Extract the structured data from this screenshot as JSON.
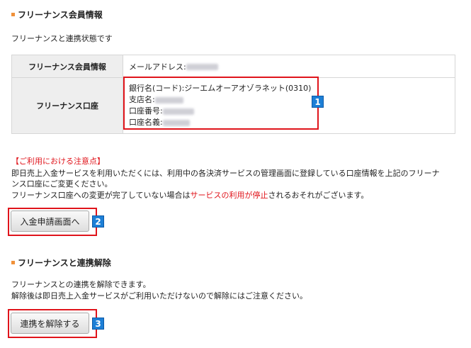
{
  "section1": {
    "title": "フリーナンス会員情報",
    "status_text": "フリーナンスと連携状態です"
  },
  "table": {
    "rows": [
      {
        "label": "フリーナンス会員情報",
        "email_label": "メールアドレス:"
      },
      {
        "label": "フリーナンス口座",
        "bank_line": "銀行名(コード):ジーエムオーアオゾラネット(0310)",
        "branch_label": "支店名:",
        "account_no_label": "口座番号:",
        "account_name_label": "口座名義:"
      }
    ]
  },
  "notice": {
    "title": "【ご利用における注意点】",
    "line1": "即日売上入金サービスを利用いただくには、利用中の各決済サービスの管理画面に登録している口座情報を上記のフリーナ",
    "line2": "ンス口座にご変更ください。",
    "line3_pre": "フリーナンス口座への変更が完了していない場合は",
    "line3_red": "サービスの利用が停止",
    "line3_post": "されるおそれがございます。"
  },
  "buttons": {
    "apply_label": "入金申請画面へ",
    "unlink_label": "連携を解除する"
  },
  "section2": {
    "title": "フリーナンスと連携解除",
    "line1": "フリーナンスとの連携を解除できます。",
    "line2": "解除後は即日売上入金サービスがご利用いただけないので解除にはご注意ください。"
  },
  "badges": [
    "1",
    "2",
    "3"
  ],
  "colors": {
    "accent": "#f0913a",
    "highlight_red": "#e0141b",
    "badge_blue": "#1d7fd6"
  }
}
